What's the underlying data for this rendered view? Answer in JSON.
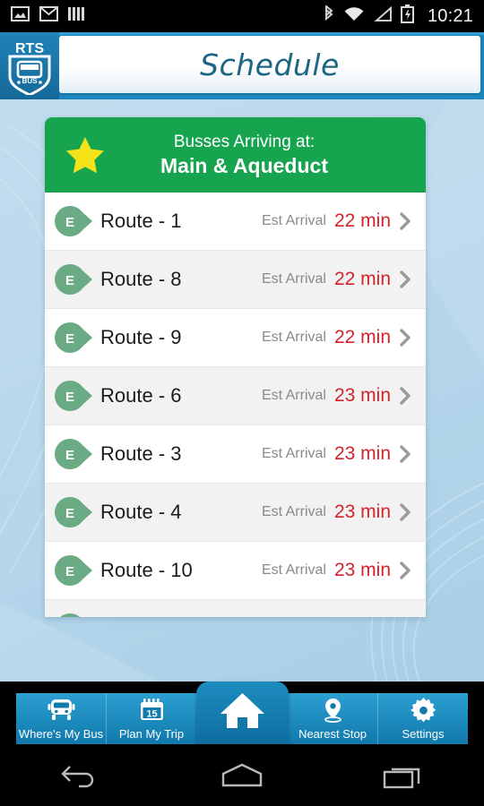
{
  "status_bar": {
    "time": "10:21",
    "left_icons": [
      "image-icon",
      "gmail-icon",
      "bars-icon"
    ],
    "right_icons": [
      "bluetooth-icon",
      "wifi-icon",
      "signal-icon",
      "battery-charging-icon"
    ]
  },
  "app_bar": {
    "logo_top": "RTS",
    "logo_bottom": "BUS",
    "title": "Schedule"
  },
  "card": {
    "header": {
      "favorite_icon": "star-icon",
      "line1": "Busses Arriving at:",
      "line2": "Main & Aqueduct"
    },
    "est_label": "Est Arrival",
    "pin_letter": "E",
    "rows": [
      {
        "route": "Route - 1",
        "est": "Est Arrival",
        "time": "22 min"
      },
      {
        "route": "Route - 8",
        "est": "Est Arrival",
        "time": "22 min"
      },
      {
        "route": "Route - 9",
        "est": "Est Arrival",
        "time": "22 min"
      },
      {
        "route": "Route - 6",
        "est": "Est Arrival",
        "time": "23 min"
      },
      {
        "route": "Route - 3",
        "est": "Est Arrival",
        "time": "23 min"
      },
      {
        "route": "Route - 4",
        "est": "Est Arrival",
        "time": "23 min"
      },
      {
        "route": "Route - 10",
        "est": "Est Arrival",
        "time": "23 min"
      }
    ]
  },
  "bottom_nav": {
    "items": [
      {
        "label": "Where's My Bus",
        "icon": "bus-icon"
      },
      {
        "label": "Plan My Trip",
        "icon": "calendar-icon",
        "badge": "15"
      },
      {
        "label": "",
        "icon": "home-icon"
      },
      {
        "label": "Nearest Stop",
        "icon": "map-pin-icon"
      },
      {
        "label": "Settings",
        "icon": "gear-icon"
      }
    ]
  },
  "soft_keys": [
    "back-icon",
    "home-icon",
    "recents-icon"
  ],
  "colors": {
    "accent_blue": "#1b87bd",
    "header_green": "#17a44f",
    "time_red": "#d4232a",
    "title_teal": "#1c6684",
    "pin_green": "#6aab83",
    "star_yellow": "#f5e31a",
    "page_bg": "#bad8ec"
  }
}
